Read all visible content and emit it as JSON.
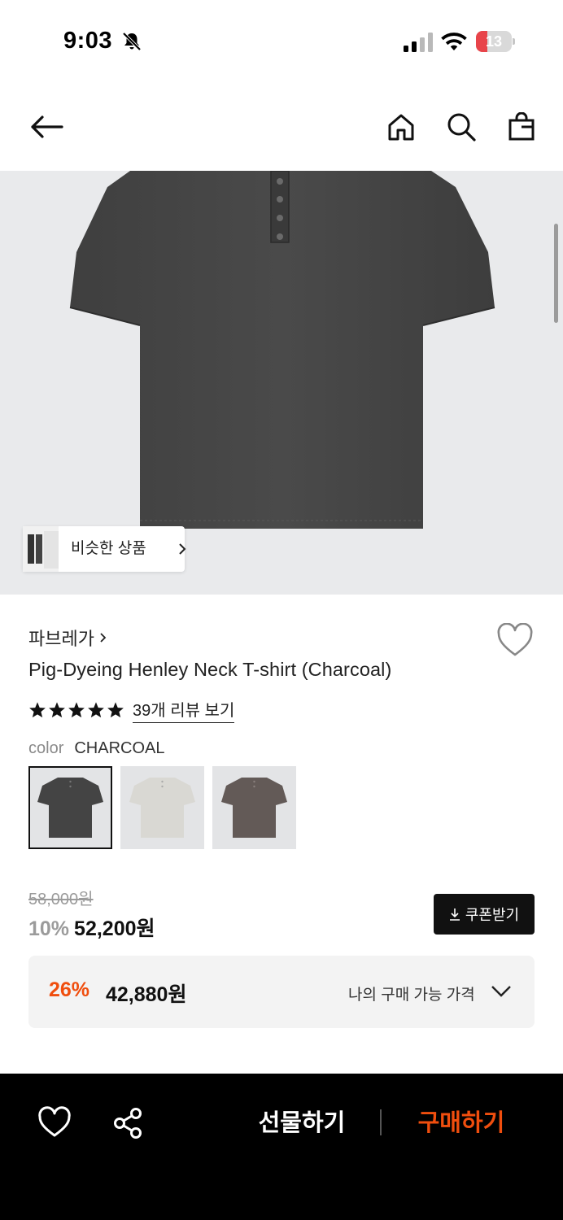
{
  "status_bar": {
    "time": "9:03",
    "battery_level": "13",
    "icons": [
      "bell-slash-icon",
      "signal-icon",
      "wifi-icon",
      "battery-icon"
    ]
  },
  "nav": {
    "icons": [
      "back-arrow-icon",
      "home-icon",
      "search-icon",
      "shopping-bag-icon"
    ]
  },
  "similar": {
    "label": "비슷한 상품"
  },
  "product": {
    "brand": "파브레가",
    "title": "Pig-Dyeing Henley Neck T-shirt (Charcoal)",
    "rating_stars": 5,
    "review_link": "39개 리뷰 보기",
    "color_label": "color",
    "color_value": "CHARCOAL",
    "swatches": [
      {
        "name": "charcoal",
        "color": "#444444",
        "selected": true
      },
      {
        "name": "ivory",
        "color": "#d9d8d3",
        "selected": false
      },
      {
        "name": "brown",
        "color": "#635a57",
        "selected": false
      }
    ],
    "shirt_color": "#474747"
  },
  "price": {
    "original": "58,000원",
    "discount": "10%",
    "sale": "52,200원",
    "coupon_label": "쿠폰받기"
  },
  "best_price": {
    "discount": "26%",
    "price": "42,880원",
    "label": "나의 구매 가능 가격"
  },
  "bottom_bar": {
    "gift_label": "선물하기",
    "buy_label": "구매하기"
  },
  "colors": {
    "accent": "#f04e0e",
    "dark": "#111111",
    "hero_bg": "#e9eaec"
  }
}
